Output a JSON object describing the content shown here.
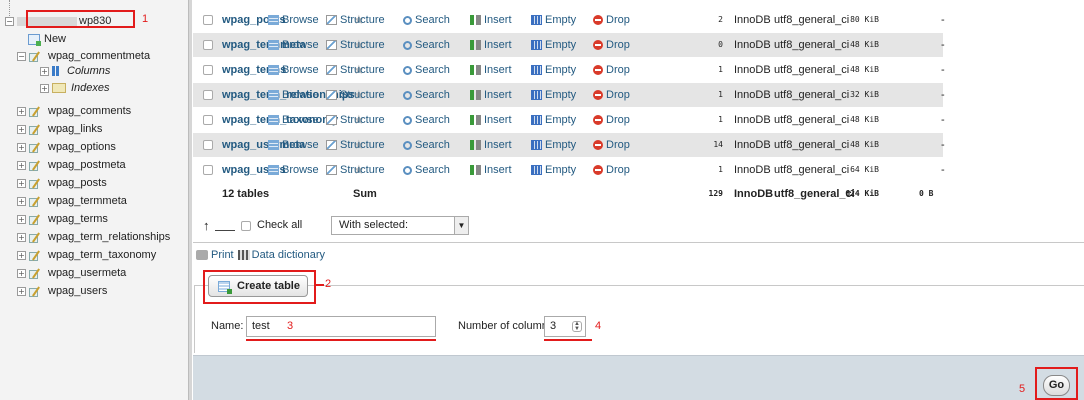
{
  "sidebar": {
    "db_name": "wp830",
    "new_label": "New",
    "commentmeta": "wpag_commentmeta",
    "columns_label": "Columns",
    "indexes_label": "Indexes",
    "tables": [
      "wpag_comments",
      "wpag_links",
      "wpag_options",
      "wpag_postmeta",
      "wpag_posts",
      "wpag_termmeta",
      "wpag_terms",
      "wpag_term_relationships",
      "wpag_term_taxonomy",
      "wpag_usermeta",
      "wpag_users"
    ]
  },
  "actions": {
    "browse": "Browse",
    "structure": "Structure",
    "search": "Search",
    "insert": "Insert",
    "empty": "Empty",
    "drop": "Drop"
  },
  "table_rows": [
    {
      "name": "wpag_posts",
      "rows": "2",
      "engine": "InnoDB",
      "collation": "utf8_general_ci",
      "size": "80 KiB",
      "overhead": "-"
    },
    {
      "name": "wpag_termmeta",
      "rows": "0",
      "engine": "InnoDB",
      "collation": "utf8_general_ci",
      "size": "48 KiB",
      "overhead": "-"
    },
    {
      "name": "wpag_terms",
      "rows": "1",
      "engine": "InnoDB",
      "collation": "utf8_general_ci",
      "size": "48 KiB",
      "overhead": "-"
    },
    {
      "name": "wpag_term_relationships",
      "rows": "1",
      "engine": "InnoDB",
      "collation": "utf8_general_ci",
      "size": "32 KiB",
      "overhead": "-"
    },
    {
      "name": "wpag_term_taxonomy",
      "rows": "1",
      "engine": "InnoDB",
      "collation": "utf8_general_ci",
      "size": "48 KiB",
      "overhead": "-"
    },
    {
      "name": "wpag_usermeta",
      "rows": "14",
      "engine": "InnoDB",
      "collation": "utf8_general_ci",
      "size": "48 KiB",
      "overhead": "-"
    },
    {
      "name": "wpag_users",
      "rows": "1",
      "engine": "InnoDB",
      "collation": "utf8_general_ci",
      "size": "64 KiB",
      "overhead": "-"
    }
  ],
  "summary": {
    "tables": "12 tables",
    "sum": "Sum",
    "rows": "129",
    "engine": "InnoDB",
    "collation": "utf8_general_ci",
    "size": "624 KiB",
    "overhead": "0 B"
  },
  "footer": {
    "check_all": "Check all",
    "with_selected": "With selected:",
    "print": "Print",
    "data_dictionary": "Data dictionary"
  },
  "create_table": {
    "button": "Create table",
    "name_label": "Name:",
    "name_value": "test",
    "columns_label": "Number of columns:",
    "columns_value": "3",
    "go": "Go"
  },
  "annotations": [
    "1",
    "2",
    "3",
    "4",
    "5"
  ],
  "colors": {
    "annotation": "#e21b1b",
    "link": "#235a81",
    "go_bar": "#d3dce3"
  }
}
